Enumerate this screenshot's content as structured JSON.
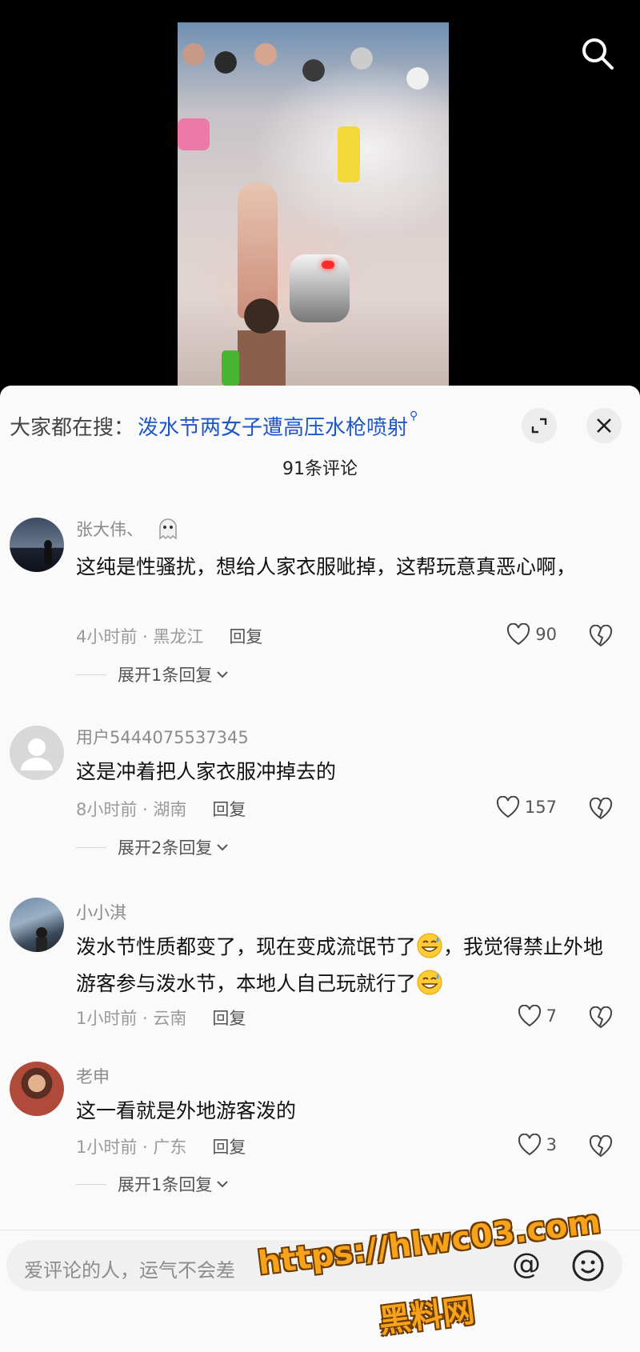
{
  "video": {
    "search_icon": "search-icon"
  },
  "panel": {
    "search_prefix": "大家都在搜：",
    "search_term": "泼水节两女子遭高压水枪喷射",
    "search_mag": "⚲",
    "comment_count": "91条评论"
  },
  "comments": [
    {
      "name": "张大伟、",
      "text": "这纯是性骚扰，想给人家衣服呲掉，这帮玩意真恶心啊，",
      "time_location": "4小时前 · 黑龙江",
      "reply": "回复",
      "likes": "90",
      "expand": "展开1条回复"
    },
    {
      "name": "用户5444075537345",
      "text": "这是冲着把人家衣服冲掉去的",
      "time_location": "8小时前 · 湖南",
      "reply": "回复",
      "likes": "157",
      "expand": "展开2条回复"
    },
    {
      "name": "小小淇",
      "text_part1": "泼水节性质都变了，现在变成流氓节了",
      "text_part2": "，我觉得禁止外地游客参与泼水节，本地人自己玩就行了",
      "time_location": "1小时前 · 云南",
      "reply": "回复",
      "likes": "7"
    },
    {
      "name": "老申",
      "text": "这一看就是外地游客泼的",
      "time_location": "1小时前 · 广东",
      "reply": "回复",
      "likes": "3",
      "expand": "展开1条回复"
    }
  ],
  "input": {
    "placeholder": "爱评论的人，运气不会差",
    "at": "@"
  },
  "watermark": {
    "url": "https://hlwc03.com",
    "site": "黑料网"
  },
  "colors": {
    "link": "#1f57c8",
    "watermark": "#f6a21a"
  }
}
